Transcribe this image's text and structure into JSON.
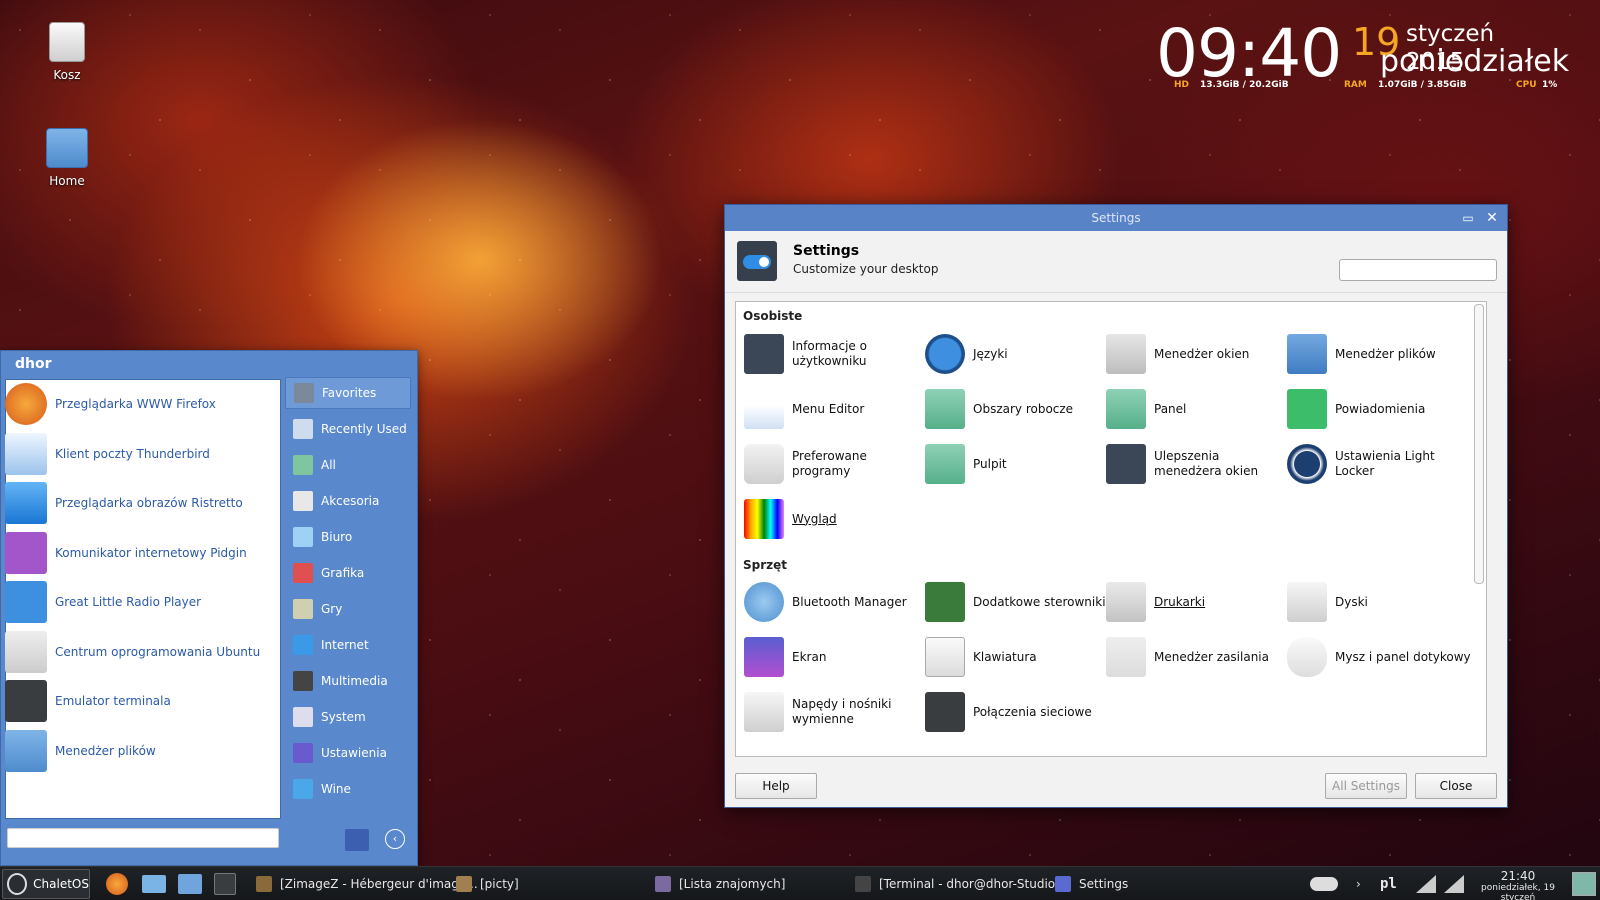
{
  "desktop": {
    "icons": [
      {
        "label": "Kosz",
        "icon": "trash-icon"
      },
      {
        "label": "Home",
        "icon": "home-folder-icon"
      }
    ]
  },
  "clock": {
    "time": "09:40",
    "day": "19",
    "month_year": "styczeń 2015",
    "weekday": "poniedziałek",
    "hd_label": "HD",
    "hd_value": "13.3GiB / 20.2GiB",
    "ram_label": "RAM",
    "ram_value": "1.07GiB / 3.85GiB",
    "cpu_label": "CPU",
    "cpu_value": "1%"
  },
  "settings": {
    "window_title": "Settings",
    "title": "Settings",
    "subtitle": "Customize your desktop",
    "search_placeholder": "",
    "sections": [
      {
        "name": "Osobiste",
        "items": [
          "Informacje o użytkowniku",
          "Języki",
          "Menedżer okien",
          "Menedżer plików",
          "Menu Editor",
          "Obszary robocze",
          "Panel",
          "Powiadomienia",
          "Preferowane programy",
          "Pulpit",
          "Ulepszenia menedżera okien",
          "Ustawienia Light Locker",
          "Wygląd"
        ]
      },
      {
        "name": "Sprzęt",
        "items": [
          "Bluetooth Manager",
          "Dodatkowe sterowniki",
          "Drukarki",
          "Dyski",
          "Ekran",
          "Klawiatura",
          "Menedżer zasilania",
          "Mysz i panel dotykowy",
          "Napędy i nośniki wymienne",
          "Połączenia sieciowe"
        ]
      }
    ],
    "buttons": {
      "help": "Help",
      "all_settings": "All Settings",
      "close": "Close"
    }
  },
  "menu": {
    "user": "dhor",
    "apps": [
      "Przeglądarka WWW Firefox",
      "Klient poczty Thunderbird",
      "Przeglądarka obrazów Ristretto",
      "Komunikator internetowy Pidgin",
      "Great Little Radio Player",
      "Centrum oprogramowania Ubuntu",
      "Emulator terminala",
      "Menedżer plików"
    ],
    "categories": [
      "Favorites",
      "Recently Used",
      "All",
      "Akcesoria",
      "Biuro",
      "Grafika",
      "Gry",
      "Internet",
      "Multimedia",
      "System",
      "Ustawienia",
      "Wine"
    ],
    "selected_category": "Favorites",
    "search_value": ""
  },
  "taskbar": {
    "start_label": "ChaletOS",
    "tasks": [
      "[ZimageZ - Hébergeur d'image...",
      "[picty]",
      "[Lista znajomych]",
      "[Terminal - dhor@dhor-Studio...",
      "Settings"
    ],
    "keyboard_layout": "pl",
    "time": "21:40",
    "date": "poniedziałek, 19 styczeń"
  },
  "colors": {
    "accent": "#5883c7",
    "menu_bg": "#5a88cc",
    "link": "#2c5aa6",
    "clock_accent": "#f5a623"
  }
}
